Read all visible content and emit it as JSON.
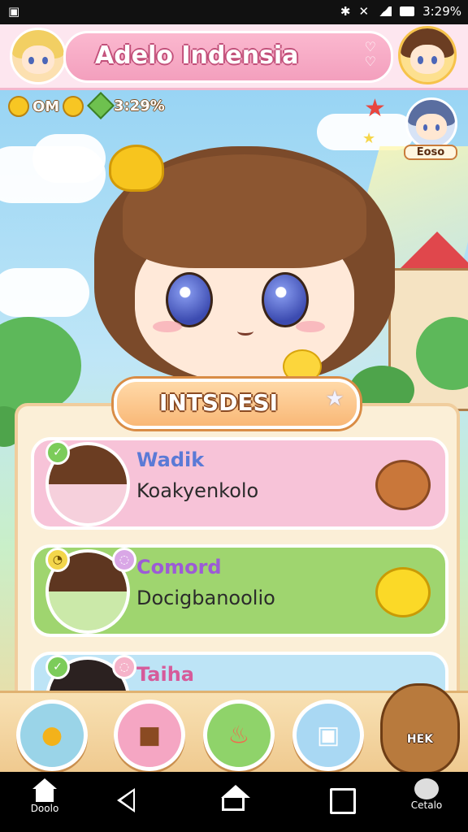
{
  "status_bar": {
    "time": "3:29%",
    "left_icon": "app-notification-icon",
    "right_icons": [
      "bluetooth-icon",
      "mute-icon",
      "signal-icon",
      "battery-icon"
    ]
  },
  "header": {
    "title": "Adelo Indensia",
    "left_avatar": "player-avatar-blonde",
    "right_avatar": "player-avatar-brown"
  },
  "resources": [
    {
      "value": "OM",
      "icon": "coin-icon"
    },
    {
      "value": "3:29%",
      "icon": "gem-icon"
    }
  ],
  "event_badge": {
    "label": "Eoso"
  },
  "panel": {
    "title": "INTSDESI",
    "cards": [
      {
        "name": "Wadik",
        "subtitle": "Koakyenkolo",
        "pet": "bear-icon",
        "color": "#f7c3d8",
        "name_color": "#5b7ad6"
      },
      {
        "name": "Comord",
        "subtitle": "Docigbanoolio",
        "pet": "yellow-chick-icon",
        "color": "#9fd56f",
        "name_color": "#9c5bd6"
      },
      {
        "name": "Taiha",
        "subtitle": "",
        "pet": "",
        "color": "#bde4f6",
        "name_color": "#d65b9a"
      }
    ]
  },
  "game_bar": {
    "buttons": [
      "chick-friends-icon",
      "pet-shop-icon",
      "flame-icon",
      "gift-box-icon"
    ],
    "mascot_label": "HEK"
  },
  "nav_bar": {
    "home_label": "Doolo",
    "right_label": "Cetalo"
  },
  "colors": {
    "header_bg": "#fde6ef",
    "title_pill": "#f39fbd",
    "panel_bg": "#fbefd7",
    "accent_orange": "#f9b877"
  }
}
